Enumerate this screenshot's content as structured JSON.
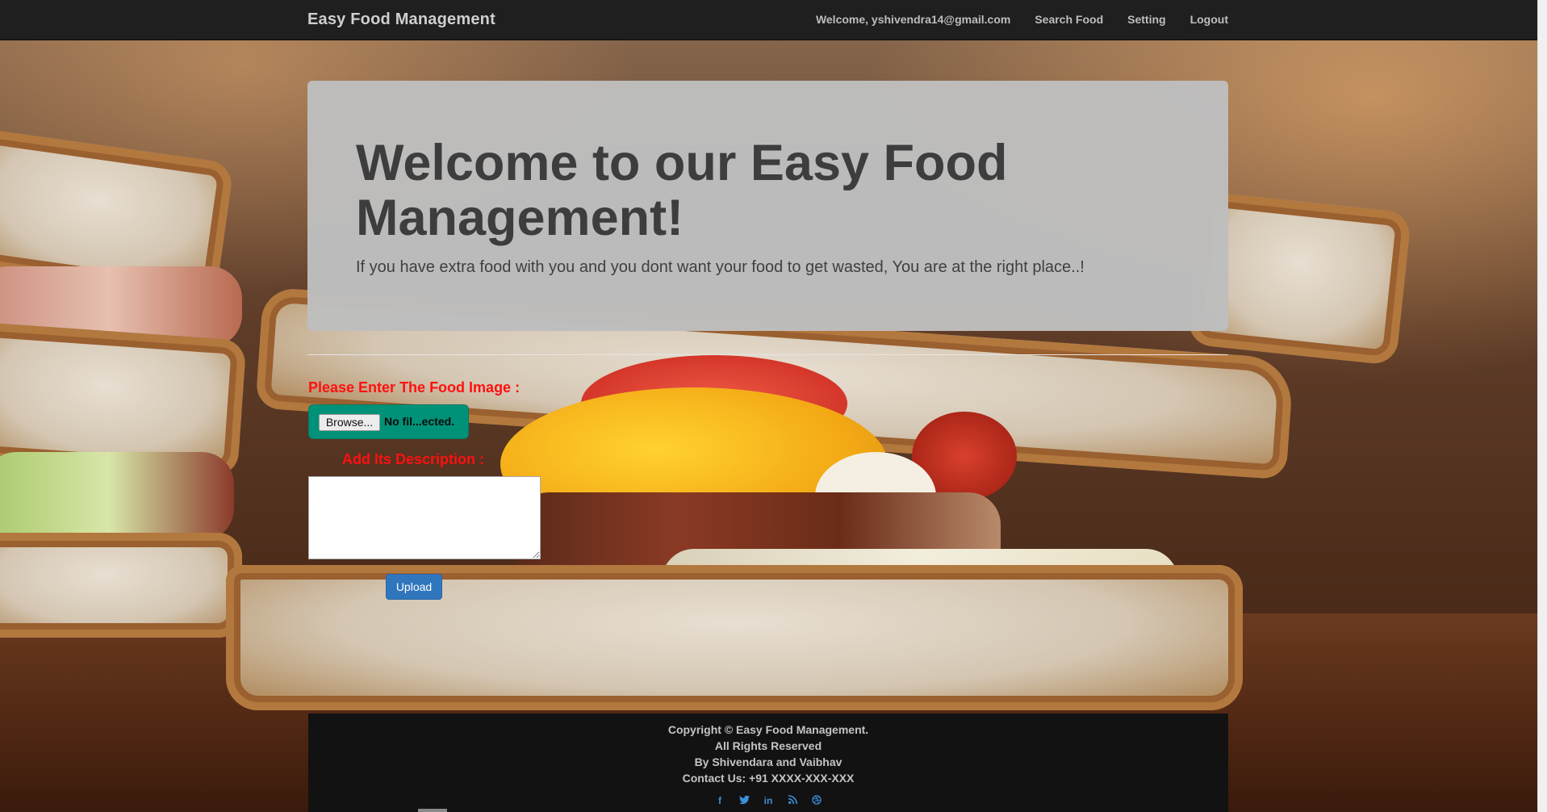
{
  "navbar": {
    "brand": "Easy Food Management",
    "links": {
      "welcome": "Welcome, yshivendra14@gmail.com",
      "search_food": "Search Food",
      "setting": "Setting",
      "logout": "Logout"
    }
  },
  "jumbotron": {
    "title": "Welcome to our Easy Food Management!",
    "subtitle": "If you have extra food with you and you dont want your food to get wasted, You are at the right place..!"
  },
  "form": {
    "image_label": "Please Enter The Food Image :",
    "browse_label": "Browse...",
    "file_status": "No fil...ected.",
    "description_label": "Add Its Description :",
    "description_value": "",
    "upload_label": "Upload"
  },
  "footer": {
    "copyright": "Copyright © Easy Food Management.",
    "rights": "All Rights Reserved",
    "authors": "By Shivendara and Vaibhav",
    "contact": "Contact Us: +91 XXXX-XXX-XXX",
    "social": {
      "facebook": "f",
      "twitter": "t",
      "linkedin": "in",
      "rss": "rss",
      "dribbble": "dribbble"
    }
  },
  "colors": {
    "navbar_bg": "#1f1f1f",
    "label_red": "#ff1010",
    "file_input_bg": "#009278",
    "upload_button": "#3076bd",
    "footer_bg": "#121212",
    "social_icon": "#3a8ed8"
  },
  "icons": {
    "facebook": "facebook-icon",
    "twitter": "twitter-icon",
    "linkedin": "linkedin-icon",
    "rss": "rss-icon",
    "dribbble": "dribbble-icon"
  }
}
